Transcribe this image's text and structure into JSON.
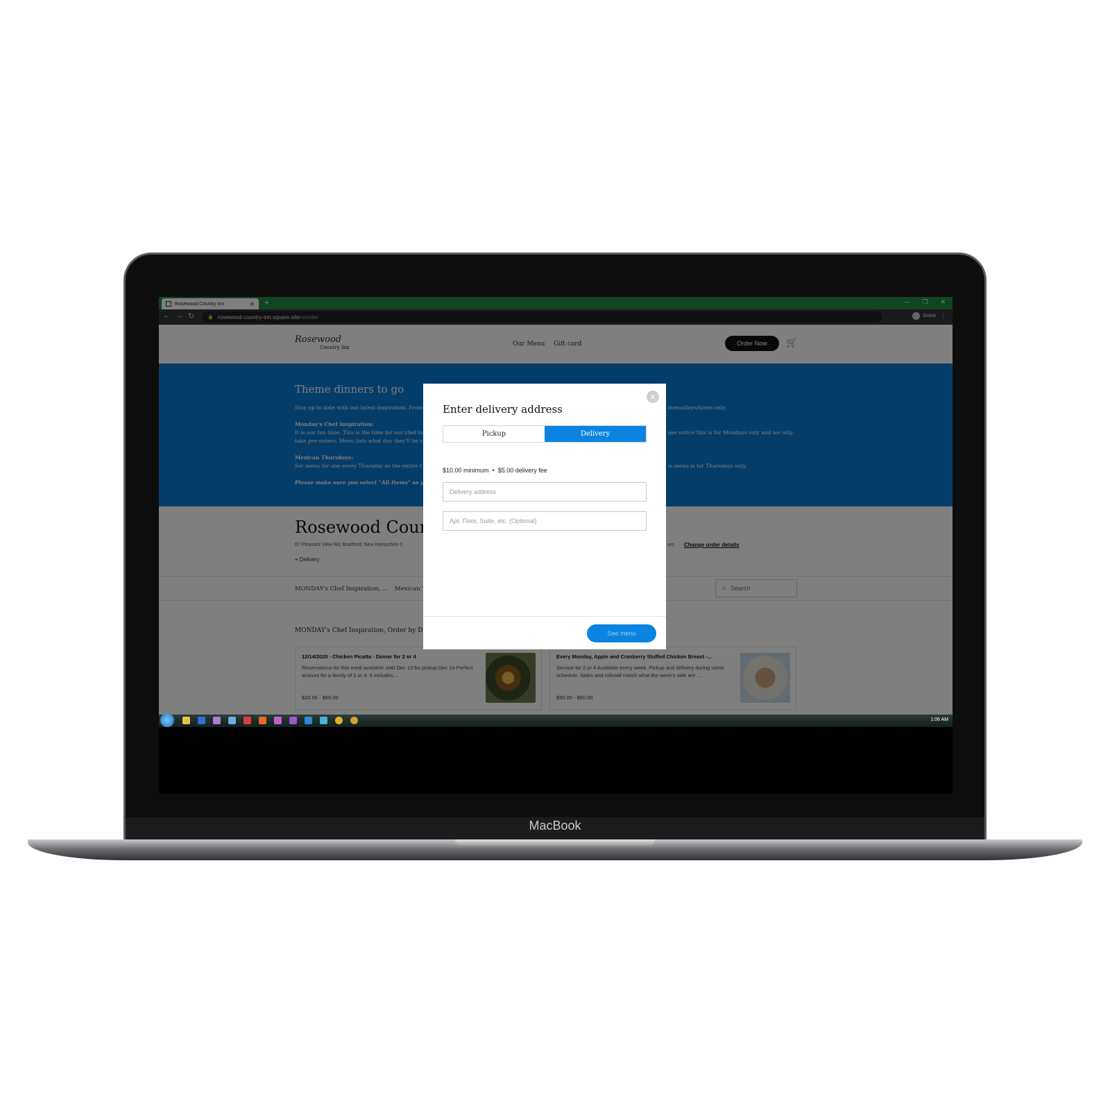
{
  "device": {
    "brand": "MacBook"
  },
  "browser": {
    "tab_title": "Rosewood Country Inn",
    "url_host": "rosewood-country-inn.square.site",
    "url_path": "/s/order",
    "profile_label": "Guest"
  },
  "site": {
    "logo_main": "Rosewood",
    "logo_sub": "Country Inn",
    "nav": [
      "Our Menu",
      "Gift card"
    ],
    "order_button": "Order Now"
  },
  "hero": {
    "title": "Theme dinners to go",
    "line1_left": "Stay up to date with our latest inspiration. From",
    "line1_right": "menu/days/times only.",
    "monday_heading": "Monday's Chef Inspiration:",
    "monday_left_1": "It is our fun time. This is the time for our chef to",
    "monday_right_1": "ase notice this is for Mondays only and we only",
    "monday_left_2": "take pre-orders. Menu lists what day they'll be s",
    "mexican_heading": "Mexican Thursdays:",
    "mexican_left": "Set menu for one every Thursday so the entire f",
    "mexican_right": "is menu is for Thursdays only.",
    "note": "Please make sure you select \"All Items\" so you c"
  },
  "business": {
    "name": "Rosewood Count",
    "address": "67 Pleasant View Rd, Bradford, New Hampshire 0",
    "hours_tail": "urs",
    "change_order": "Change order details",
    "fulfillment": "Delivery"
  },
  "categories": [
    "MONDAY's Chef Inspiration, ...",
    "Mexican Th"
  ],
  "search_placeholder": "Search",
  "section_title": "MONDAY's Chef Inspiration, Order by Da",
  "items": [
    {
      "title": "12/14/2020 - Chicken Picatta - Dinner for 2 or 4",
      "desc": "Reservations for this meal available until Dec 13 for pickup Dec 14   Perfect amount for a family of 2 or 4. It includes:...",
      "price": "$32.00 - $60.00"
    },
    {
      "title": "Every Monday, Apple and Cranberry Stuffed Chicken Breast -...",
      "desc": "Service for 2 or 4 Available every week. Pickup and delivery during same schedule. Sides and rollswill match what the week's side are. ...",
      "price": "$30.00 - $60.00"
    }
  ],
  "modal": {
    "title": "Enter delivery address",
    "tabs": [
      "Pickup",
      "Delivery"
    ],
    "selected_tab": "Delivery",
    "minimum": "$10.00 minimum",
    "separator": "•",
    "fee": "$5.00 delivery fee",
    "address_placeholder": "Delivery address",
    "apt_placeholder": "Apt, Floor, Suite, etc. (Optional)",
    "submit": "See menu"
  },
  "taskbar": {
    "clock": "1:06 AM"
  },
  "colors": {
    "accent": "#0a84e0",
    "hero": "#0a7ad4",
    "tabbar": "#1e8a42"
  }
}
